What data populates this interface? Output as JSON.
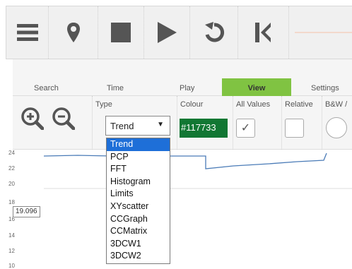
{
  "toolbar": {
    "icons": [
      "menu-icon",
      "map-pin-icon",
      "stop-icon",
      "play-icon",
      "undo-icon",
      "skip-back-icon"
    ]
  },
  "tabs": [
    {
      "label": "Search",
      "active": false
    },
    {
      "label": "Time",
      "active": false
    },
    {
      "label": "Play",
      "active": false
    },
    {
      "label": "View",
      "active": true
    },
    {
      "label": "Settings",
      "active": false
    }
  ],
  "view_panel": {
    "zoom_in_icon": "zoom-in-icon",
    "zoom_out_icon": "zoom-out-icon",
    "type_label": "Type",
    "type_value": "Trend",
    "colour_label": "Colour",
    "colour_value": "#117733",
    "all_values_label": "All Values",
    "all_values_checked": true,
    "relative_label": "Relative",
    "relative_checked": false,
    "bw_label": "B&W /"
  },
  "type_options": [
    "Trend",
    "PCP",
    "FFT",
    "Histogram",
    "Limits",
    "XYscatter",
    "CCGraph",
    "CCMatrix",
    "3DCW1",
    "3DCW2"
  ],
  "selected_type": "Trend",
  "chart_data": {
    "type": "line",
    "y_ticks": [
      "24",
      "22",
      "20",
      "18",
      "16",
      "14",
      "12",
      "10"
    ],
    "readout": "19.096",
    "line_color": "#4a7bb7"
  }
}
